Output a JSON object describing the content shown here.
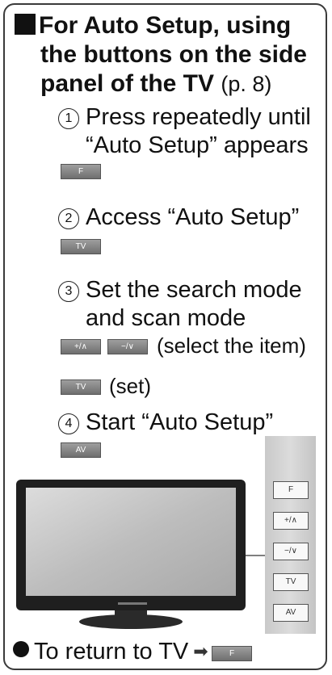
{
  "header": {
    "line1": "For Auto Setup, using",
    "line2": "the buttons on the side",
    "line3": "panel of the TV",
    "page_ref": "(p. 8)"
  },
  "steps": [
    {
      "number": "1",
      "line1": "Press repeatedly until",
      "line2": "“Auto Setup” appears",
      "buttons": [
        "F"
      ]
    },
    {
      "number": "2",
      "line1": "Access “Auto Setup”",
      "buttons": [
        "TV"
      ]
    },
    {
      "number": "3",
      "line1": "Set the search mode",
      "line2": "and scan mode",
      "row1_buttons": [
        "+/∧",
        "−/∨"
      ],
      "row1_note": "(select the item)",
      "row2_buttons": [
        "TV"
      ],
      "row2_note": "(set)"
    },
    {
      "number": "4",
      "line1": "Start “Auto Setup”",
      "buttons": [
        "AV"
      ]
    }
  ],
  "side_panel": {
    "buttons": [
      "F",
      "+/∧",
      "−/∨",
      "TV",
      "AV"
    ]
  },
  "footer": {
    "text": "To return to TV",
    "arrow": "➡",
    "button": "F"
  },
  "colors": {
    "button_fill": "#8a8a8a",
    "panel_border": "#3a3a3a",
    "screen_dark": "#1f1f1f"
  }
}
